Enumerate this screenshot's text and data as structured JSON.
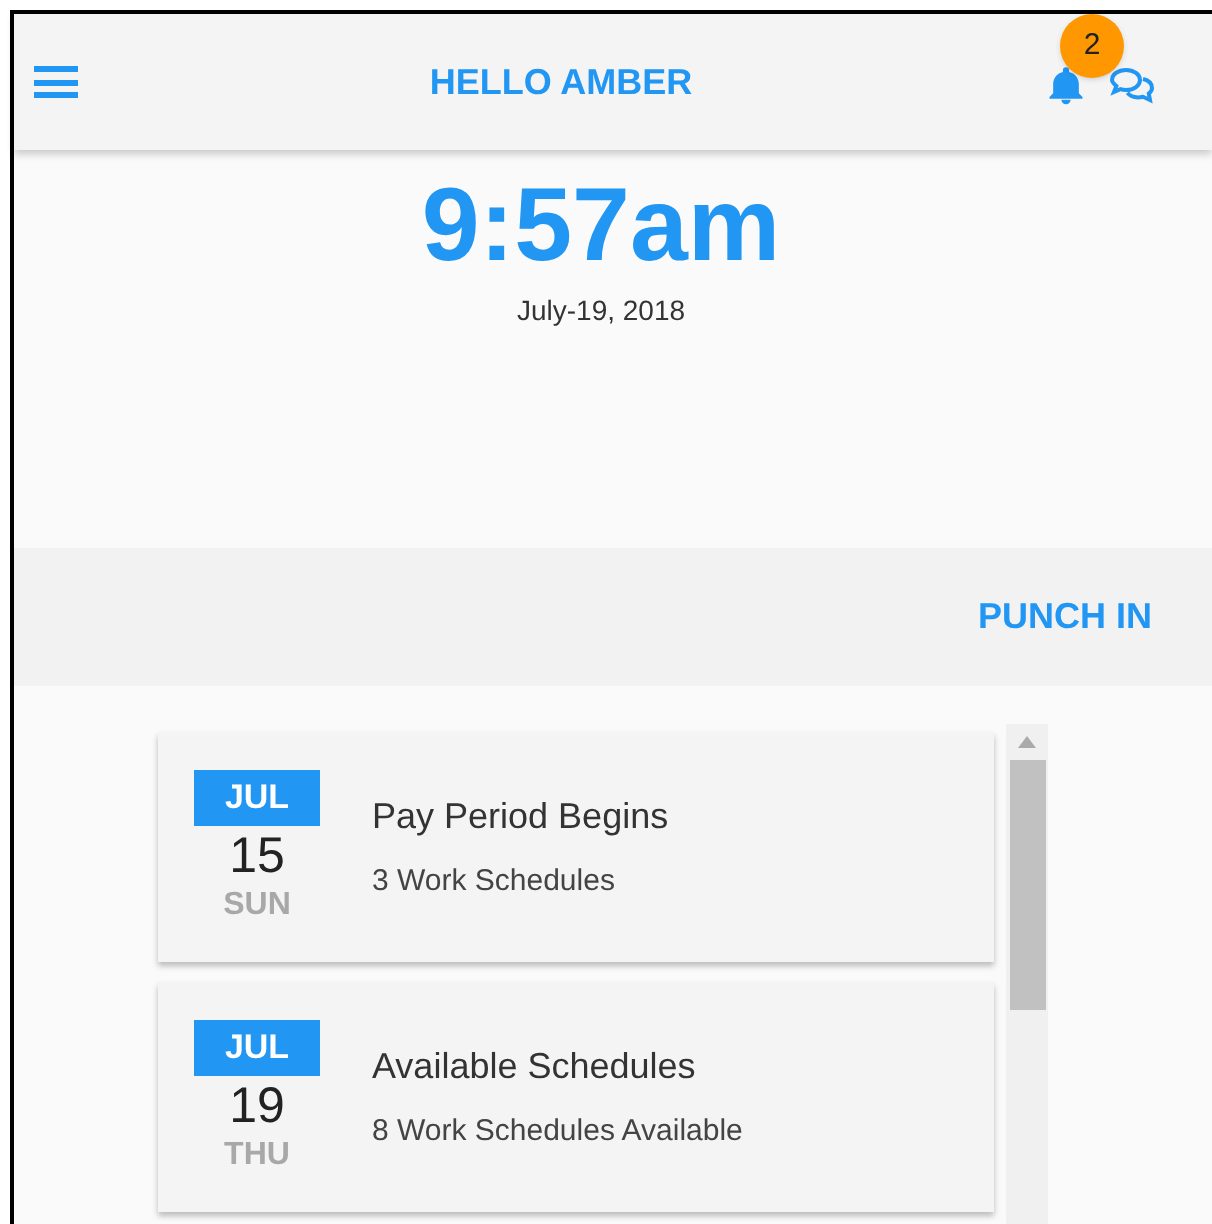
{
  "header": {
    "title": "HELLO AMBER",
    "notification_count": "2"
  },
  "clock": {
    "time": "9:57am",
    "date": "July-19, 2018"
  },
  "punch_button": "PUNCH IN",
  "events": [
    {
      "month": "JUL",
      "day": "15",
      "weekday": "SUN",
      "title": "Pay Period Begins",
      "subtitle": "3 Work Schedules"
    },
    {
      "month": "JUL",
      "day": "19",
      "weekday": "THU",
      "title": "Available Schedules",
      "subtitle": "8 Work Schedules Available"
    }
  ]
}
